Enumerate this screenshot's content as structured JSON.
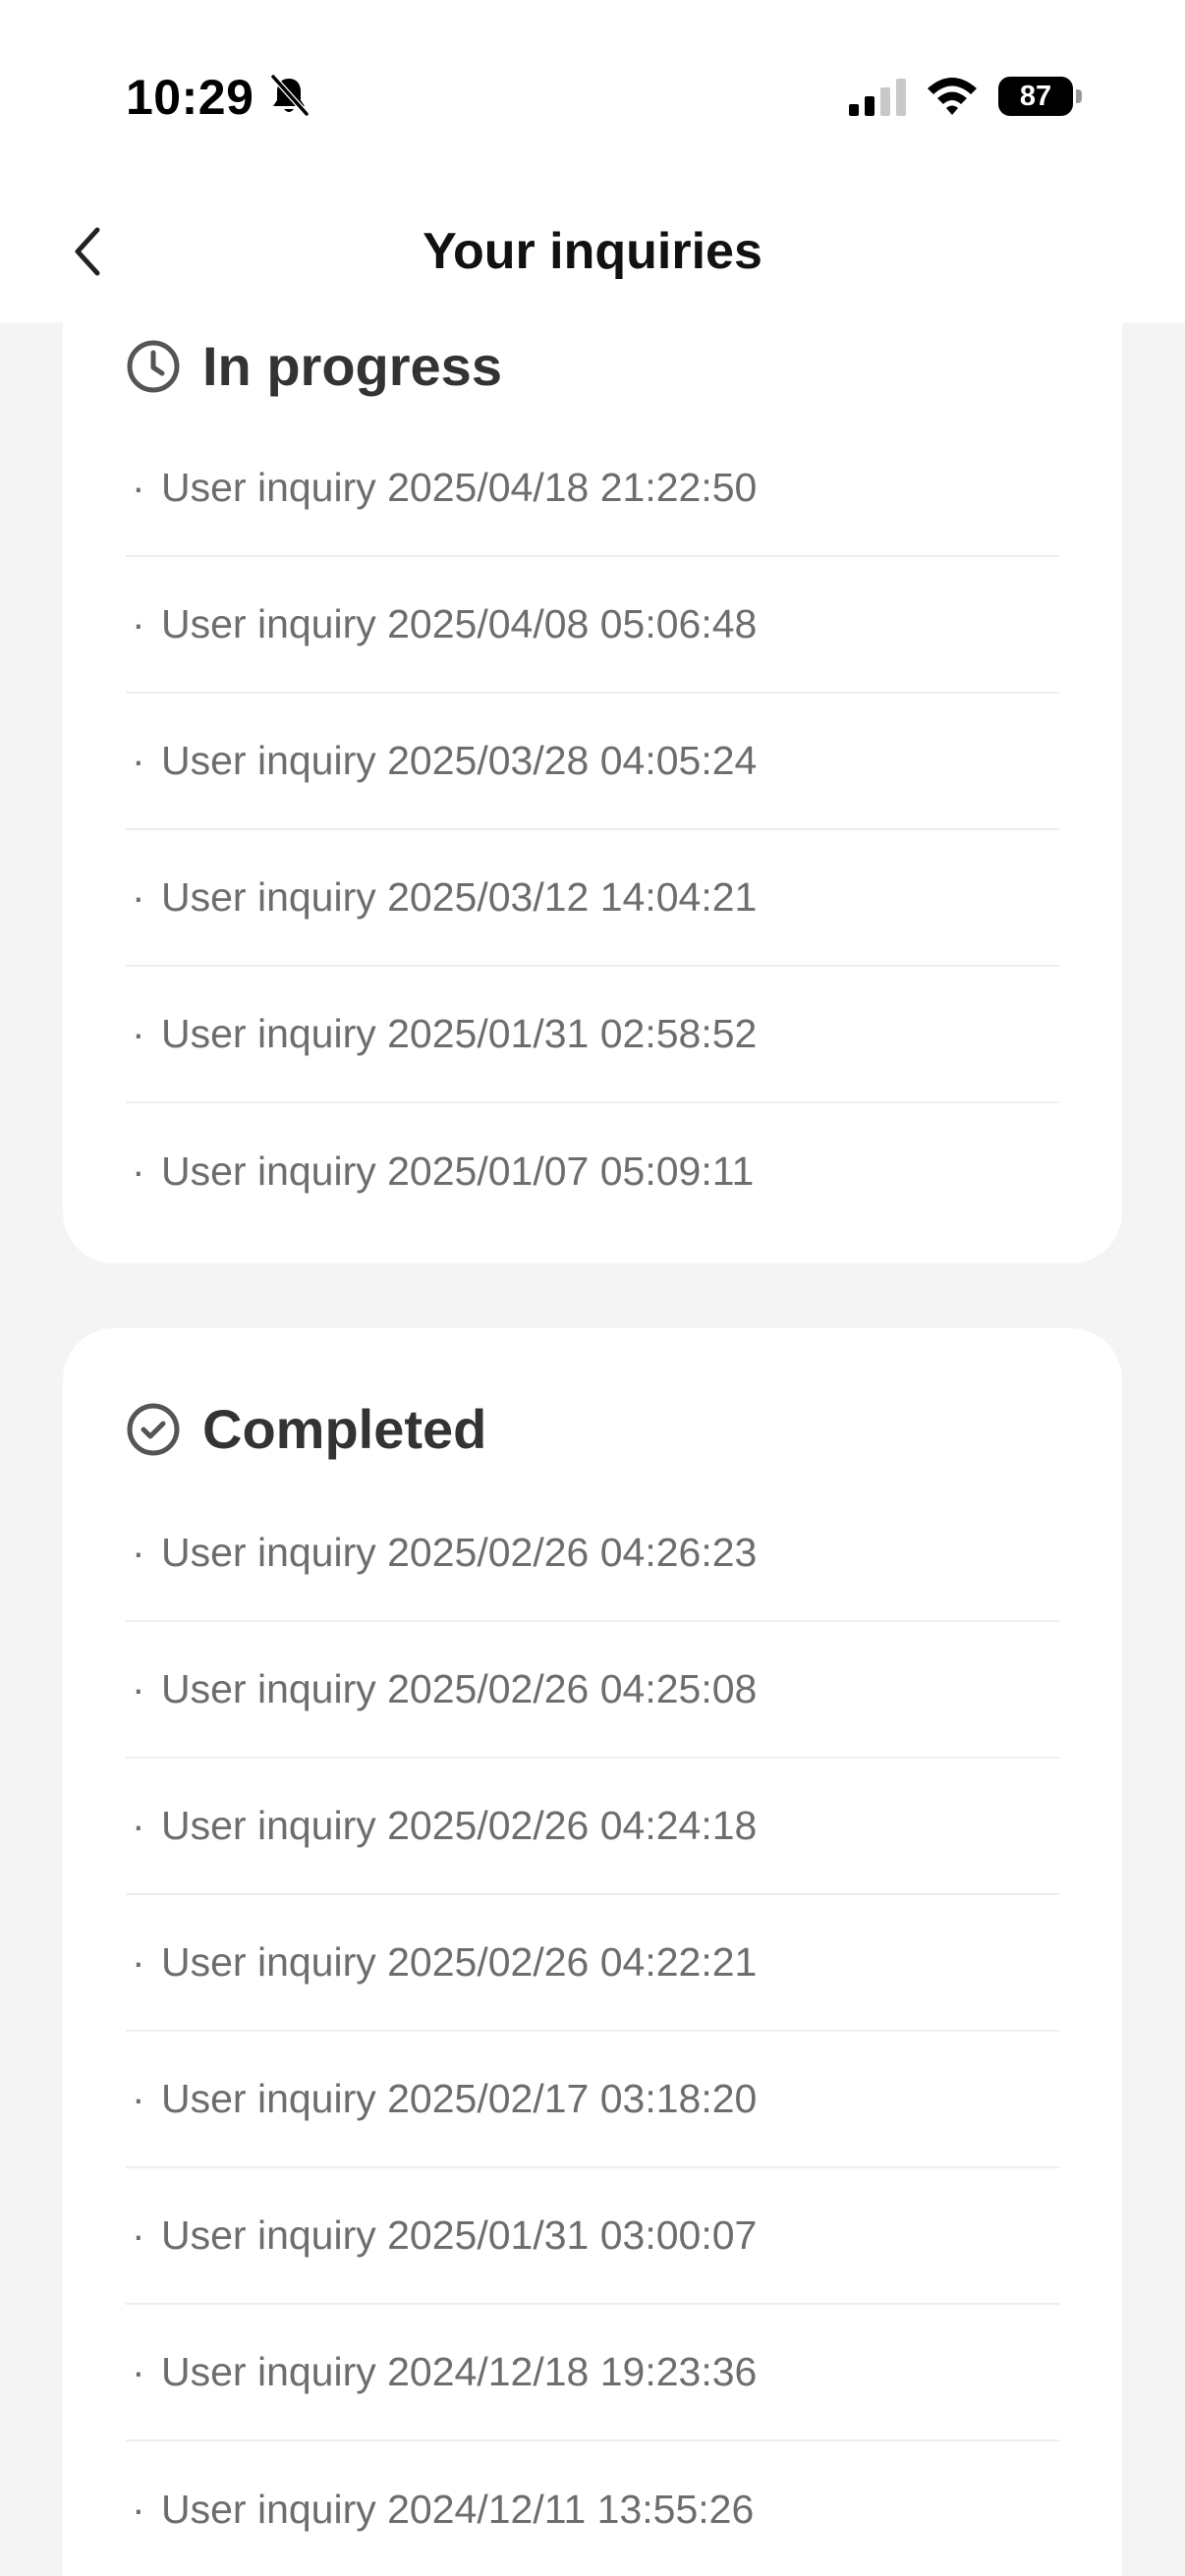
{
  "status_bar": {
    "time": "10:29",
    "battery": "87",
    "icons": [
      "bell-off-icon",
      "signal-icon",
      "wifi-icon",
      "battery-icon"
    ]
  },
  "header": {
    "title": "Your inquiries",
    "back_icon": "chevron-left-icon"
  },
  "in_progress": {
    "title": "In progress",
    "icon": "clock-icon",
    "items": [
      "User inquiry 2025/04/18 21:22:50",
      "User inquiry 2025/04/08 05:06:48",
      "User inquiry 2025/03/28 04:05:24",
      "User inquiry 2025/03/12 14:04:21",
      "User inquiry 2025/01/31 02:58:52",
      "User inquiry 2025/01/07 05:09:11"
    ]
  },
  "completed": {
    "title": "Completed",
    "icon": "check-circle-icon",
    "items": [
      "User inquiry 2025/02/26 04:26:23",
      "User inquiry 2025/02/26 04:25:08",
      "User inquiry 2025/02/26 04:24:18",
      "User inquiry 2025/02/26 04:22:21",
      "User inquiry 2025/02/17 03:18:20",
      "User inquiry 2025/01/31 03:00:07",
      "User inquiry 2024/12/18 19:23:36",
      "User inquiry 2024/12/11 13:55:26"
    ]
  },
  "colors": {
    "background": "#f4f4f4",
    "card": "#ffffff",
    "title_text": "#333333",
    "item_text": "#6d6d6d"
  }
}
